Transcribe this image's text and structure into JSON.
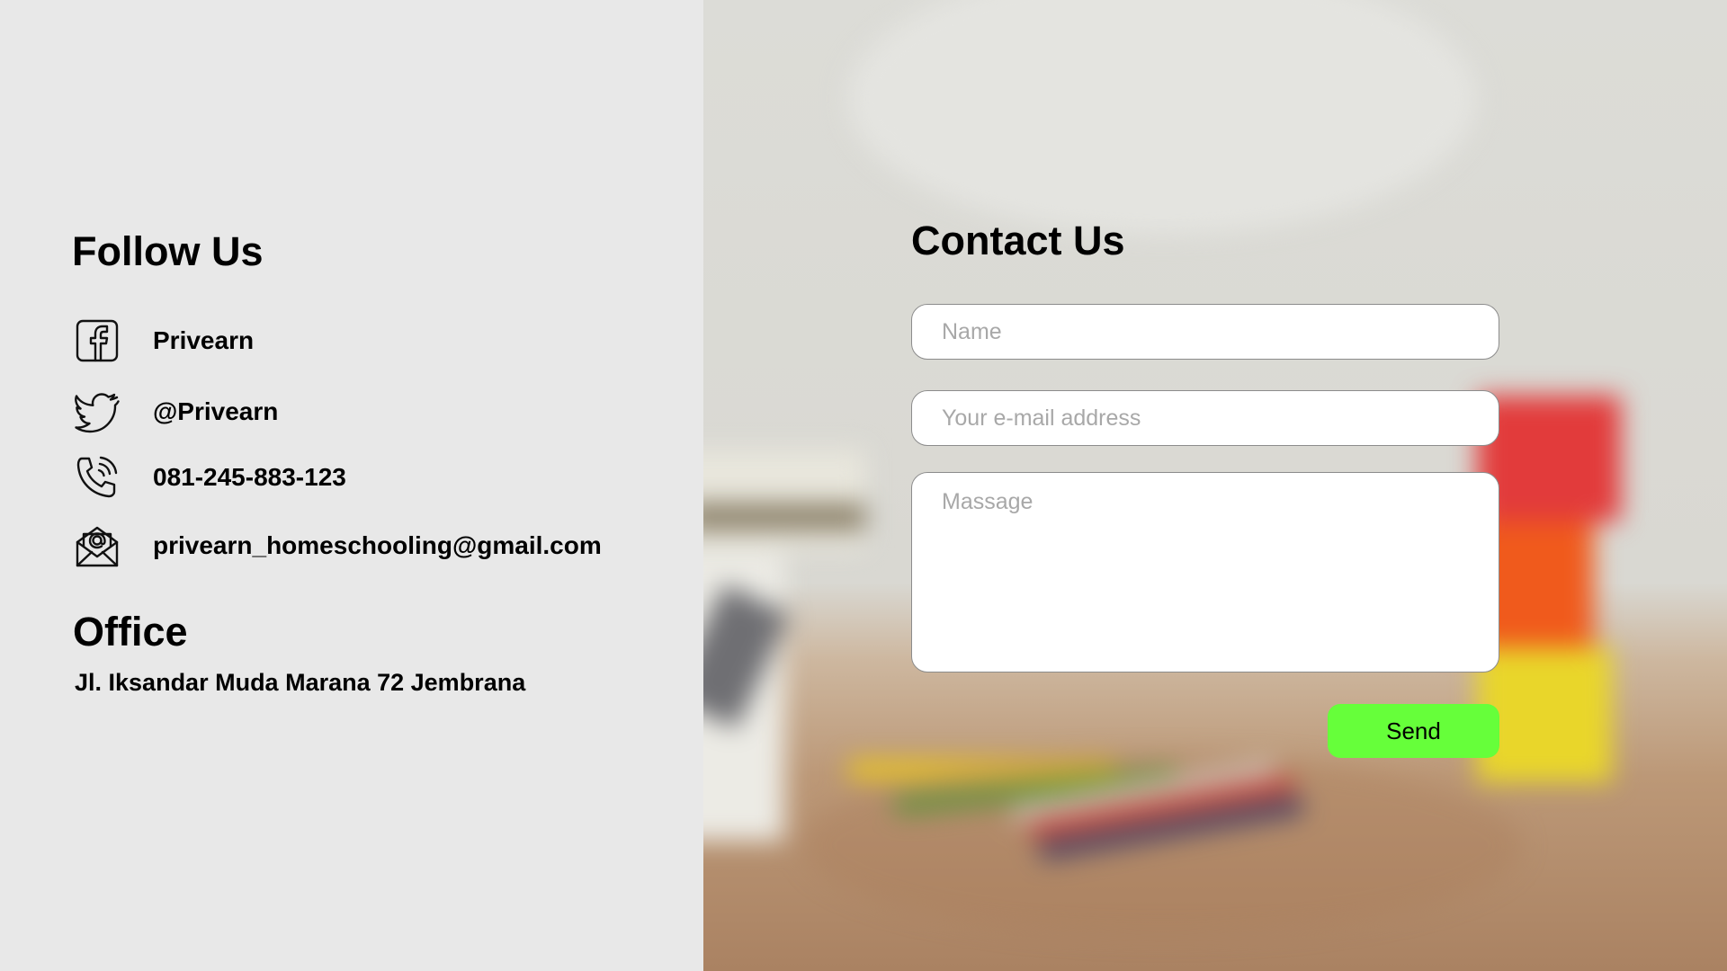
{
  "follow": {
    "title": "Follow Us",
    "items": [
      {
        "icon": "facebook-icon",
        "label": "Privearn"
      },
      {
        "icon": "twitter-icon",
        "label": "@Privearn"
      },
      {
        "icon": "phone-icon",
        "label": "081-245-883-123"
      },
      {
        "icon": "email-icon",
        "label": "privearn_homeschooling@gmail.com"
      }
    ]
  },
  "office": {
    "title": "Office",
    "address": "Jl. Iksandar Muda Marana 72 Jembrana"
  },
  "contact": {
    "title": "Contact Us",
    "name_placeholder": "Name",
    "email_placeholder": "Your e-mail address",
    "message_placeholder": "Massage",
    "send_label": "Send"
  },
  "colors": {
    "left_panel_bg": "#e8e8e8",
    "send_button": "#66ff3a",
    "field_border": "#8c8c8c"
  }
}
